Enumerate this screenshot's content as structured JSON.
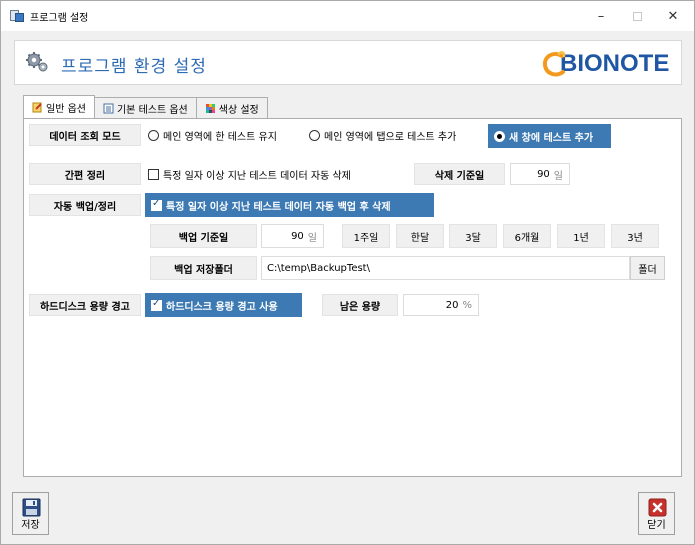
{
  "window": {
    "title": "프로그램 설정"
  },
  "header": {
    "title": "프로그램 환경 설정",
    "logo_text": "BIONOTE"
  },
  "tabs": [
    {
      "label": "일반 옵션",
      "icon": "general-options-icon",
      "active": true
    },
    {
      "label": "기본 테스트 옵션",
      "icon": "test-options-icon",
      "active": false
    },
    {
      "label": "색상 설정",
      "icon": "color-grid-icon",
      "active": false
    }
  ],
  "data_view_mode": {
    "label": "데이터 조회 모드",
    "options": [
      "메인 영역에 한 테스트 유지",
      "메인 영역에 탭으로 테스트 추가",
      "새 창에 테스트 추가"
    ],
    "selected_index": 2
  },
  "simple_cleanup": {
    "label": "간편 정리",
    "checkbox_label": "특정 일자 이상 지난 테스트 데이터 자동 삭제",
    "checked": false,
    "delete_basis_label": "삭제 기준일",
    "delete_basis_value": "90",
    "delete_basis_unit": "일"
  },
  "auto_backup": {
    "label": "자동 백업/정리",
    "checkbox_label": "특정 일자 이상 지난 테스트 데이터 자동 백업 후 삭제",
    "checked": true,
    "backup_basis_label": "백업 기준일",
    "backup_basis_value": "90",
    "backup_basis_unit": "일",
    "period_buttons": [
      "1주일",
      "한달",
      "3달",
      "6개월",
      "1년",
      "3년"
    ],
    "backup_folder_label": "백업 저장폴더",
    "backup_folder_path": "C:\\temp\\BackupTest\\",
    "folder_button": "폴더"
  },
  "disk_warning": {
    "label": "하드디스크 용량 경고",
    "checkbox_label": "하드디스크 용량 경고 사용",
    "checked": true,
    "remaining_label": "남은 용량",
    "remaining_value": "20",
    "remaining_unit": "%"
  },
  "footer": {
    "save_label": "저장",
    "close_label": "닫기"
  },
  "colors": {
    "accent": "#3d7ab4",
    "title_blue": "#2e6bb5",
    "logo_blue": "#1f57a4",
    "logo_orange": "#f39a1e",
    "close_red": "#c8302c"
  }
}
